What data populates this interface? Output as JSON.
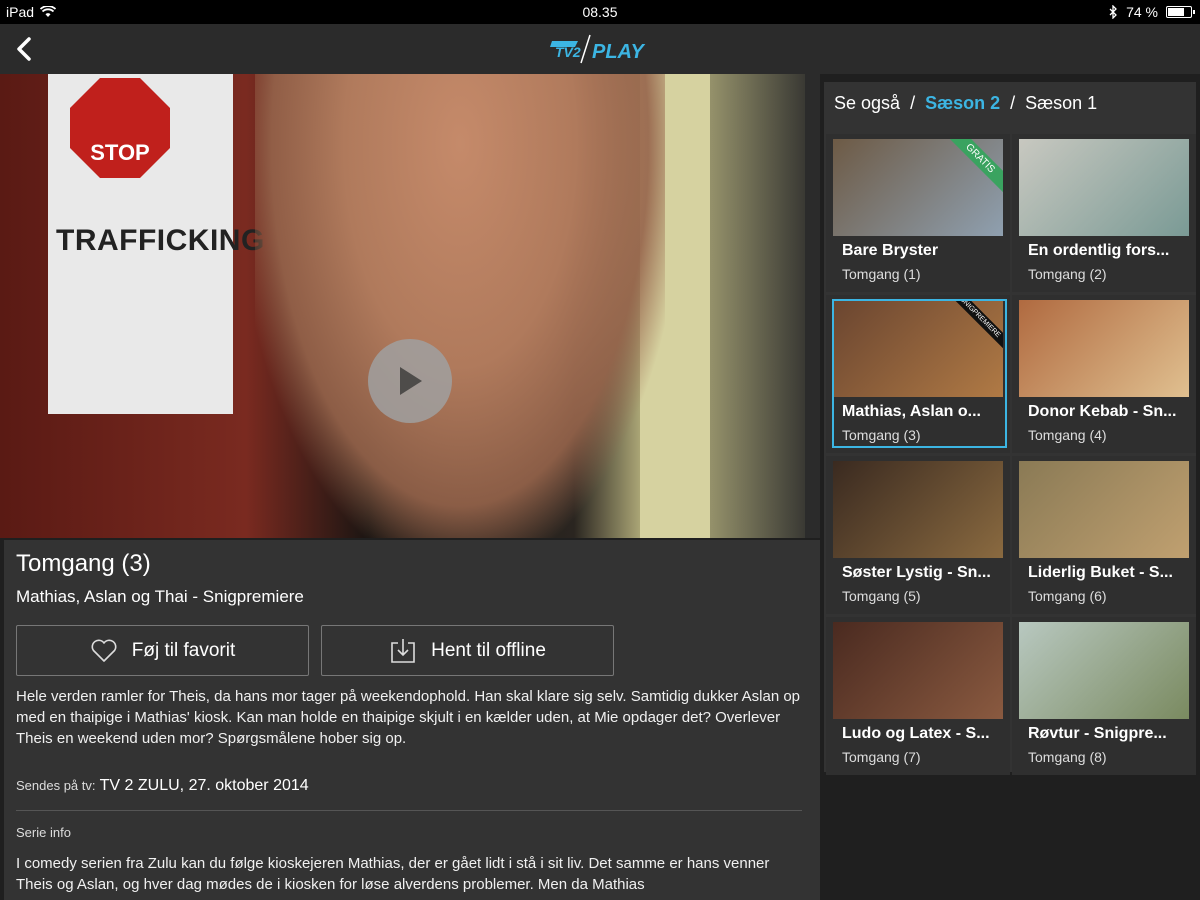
{
  "status_bar": {
    "device": "iPad",
    "time": "08.35",
    "battery": "74 %",
    "battery_level": 0.74
  },
  "nav": {
    "logo_text": "PLAY"
  },
  "hero": {
    "poster_sign": "STOP",
    "poster_title": "TRAFFICKING"
  },
  "episode": {
    "title": "Tomgang (3)",
    "subtitle": "Mathias, Aslan og Thai - Snigpremiere",
    "favorite_label": "Føj til favorit",
    "offline_label": "Hent til offline",
    "description": "Hele verden ramler for Theis, da hans mor tager på weekendophold. Han skal klare sig selv. Samtidig dukker Aslan op med en thaipige i Mathias' kiosk. Kan man holde en thaipige skjult i en kælder uden, at Mie opdager det? Overlever Theis en weekend uden mor? Spørgsmålene hober sig op.",
    "airing_label": "Sendes på tv:",
    "airing_value": "TV 2 ZULU, 27. oktober 2014",
    "serie_info_label": "Serie info",
    "serie_info_text": "I comedy serien fra Zulu kan du følge kioskejeren Mathias, der er gået lidt i stå i sit liv. Det samme er hans venner Theis og Aslan, og hver dag mødes de i kiosken for løse alverdens problemer. Men da Mathias"
  },
  "sidebar": {
    "see_also": "Se også",
    "separator": "/",
    "season_active": "Sæson 2",
    "season_other": "Sæson 1",
    "accent": "#3cb5e3",
    "episodes": [
      {
        "title": "Bare Bryster",
        "sub": "Tomgang (1)",
        "badge": "GRATIS",
        "thumb": [
          "#6d5a45",
          "#8fa0b0"
        ]
      },
      {
        "title": "En ordentlig fors...",
        "sub": "Tomgang (2)",
        "badge": "",
        "thumb": [
          "#c8c8c0",
          "#7a9a95"
        ]
      },
      {
        "title": "Mathias, Aslan o...",
        "sub": "Tomgang (3)",
        "badge": "SNIGPREMIERE",
        "thumb": [
          "#6a4530",
          "#b07a45"
        ]
      },
      {
        "title": "Donor Kebab - Sn...",
        "sub": "Tomgang (4)",
        "badge": "",
        "thumb": [
          "#b06a40",
          "#e0c090"
        ]
      },
      {
        "title": "Søster Lystig - Sn...",
        "sub": "Tomgang (5)",
        "badge": "",
        "thumb": [
          "#3a2a20",
          "#8a6a40"
        ]
      },
      {
        "title": "Liderlig Buket - S...",
        "sub": "Tomgang (6)",
        "badge": "",
        "thumb": [
          "#8a7a55",
          "#c0a070"
        ]
      },
      {
        "title": "Ludo og Latex - S...",
        "sub": "Tomgang (7)",
        "badge": "",
        "thumb": [
          "#4a2a20",
          "#8a5a40"
        ]
      },
      {
        "title": "Røvtur - Snigpre...",
        "sub": "Tomgang (8)",
        "badge": "",
        "thumb": [
          "#b8c8c0",
          "#7a8a60"
        ]
      }
    ]
  }
}
